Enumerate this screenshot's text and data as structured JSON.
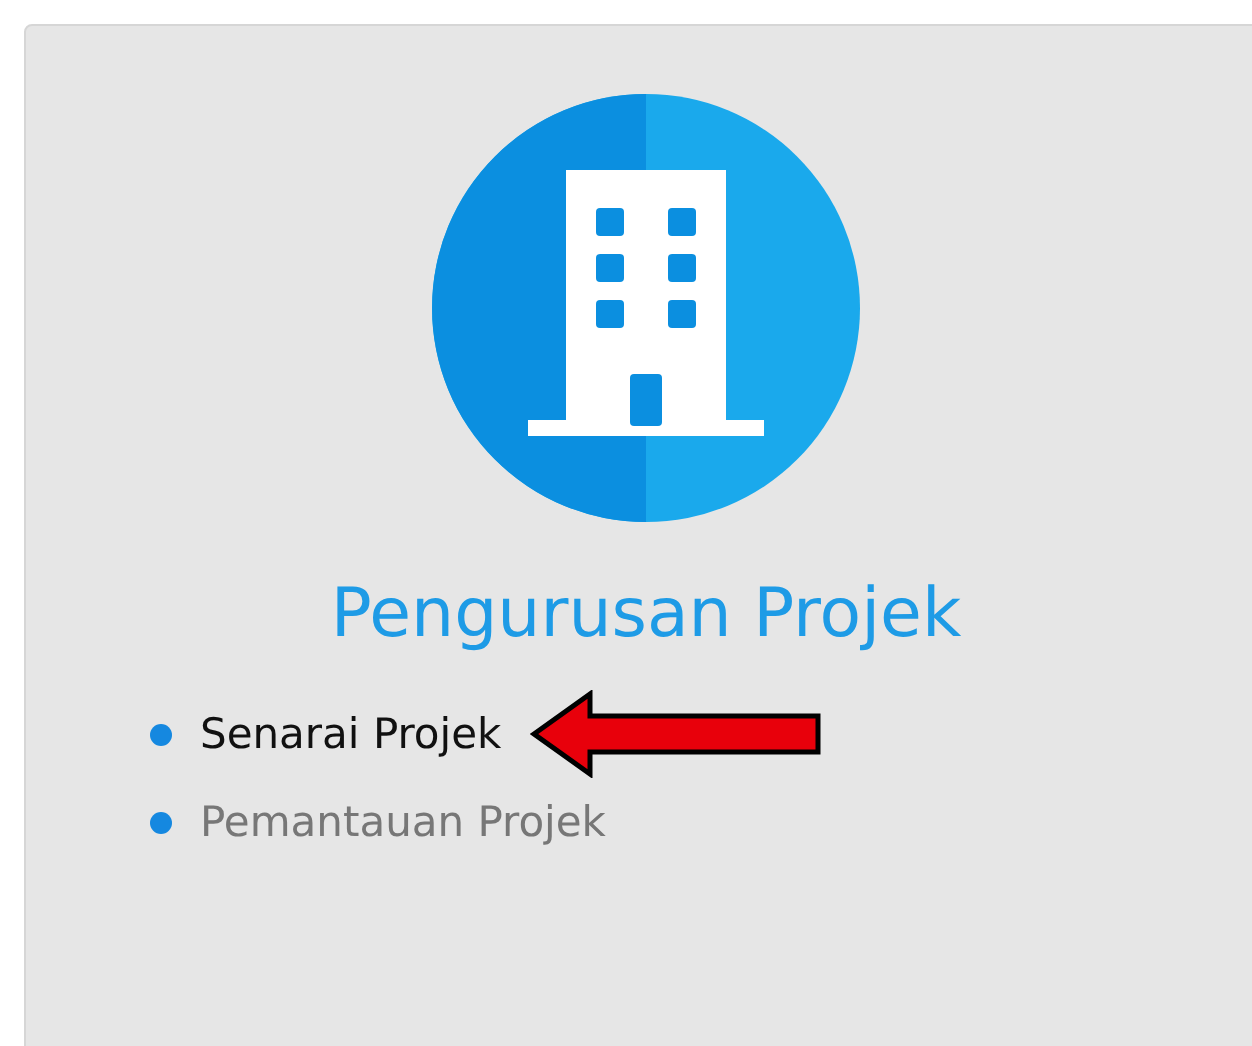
{
  "module": {
    "title": "Pengurusan Projek"
  },
  "links": [
    {
      "label": "Senarai Projek",
      "selected": true
    },
    {
      "label": "Pemantauan Projek",
      "selected": false
    }
  ]
}
